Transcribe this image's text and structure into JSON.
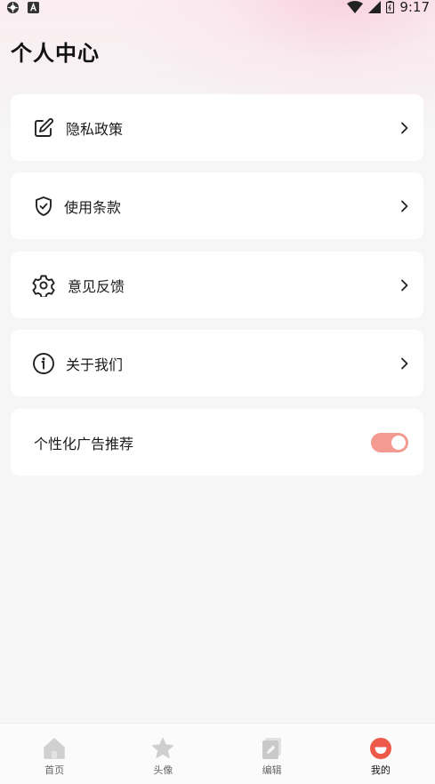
{
  "status_bar": {
    "time": "9:17",
    "left_icons": [
      "settings-app-icon",
      "font-a-icon"
    ],
    "right_icons": [
      "wifi-icon",
      "signal-icon",
      "battery-icon"
    ]
  },
  "page": {
    "title": "个人中心"
  },
  "menu": {
    "items": [
      {
        "label": "隐私政策",
        "icon": "edit-icon"
      },
      {
        "label": "使用条款",
        "icon": "shield-check-icon"
      },
      {
        "label": "意见反馈",
        "icon": "gear-icon"
      },
      {
        "label": "关于我们",
        "icon": "info-icon"
      }
    ],
    "ad_toggle": {
      "label": "个性化广告推荐",
      "checked": true,
      "accent": "#f39a91"
    }
  },
  "tabbar": {
    "tabs": [
      {
        "label": "首页",
        "icon": "home-icon",
        "active": false
      },
      {
        "label": "头像",
        "icon": "star-icon",
        "active": false
      },
      {
        "label": "编辑",
        "icon": "edit-doc-icon",
        "active": false
      },
      {
        "label": "我的",
        "icon": "profile-face-icon",
        "active": true
      }
    ],
    "active_color": "#ee5a4a"
  }
}
